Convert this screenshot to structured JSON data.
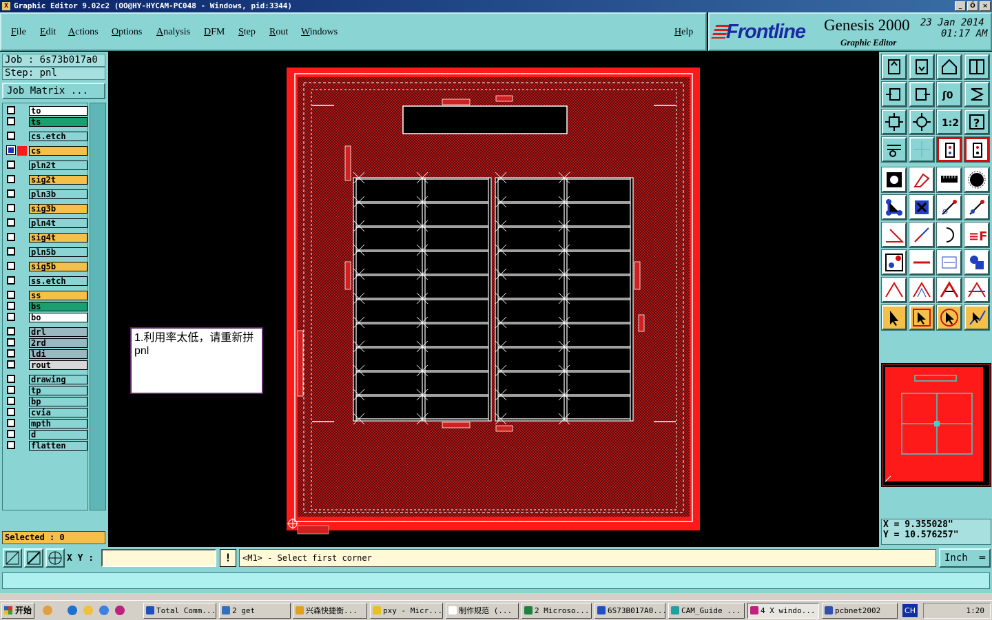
{
  "window": {
    "title": "Graphic Editor 9.02c2 (OO@HY-HYCAM-PC048 - Windows, pid:3344)",
    "buttons": [
      "_",
      "Ő",
      "×"
    ]
  },
  "menu": {
    "items": [
      "File",
      "Edit",
      "Actions",
      "Options",
      "Analysis",
      "DFM",
      "Step",
      "Rout",
      "Windows"
    ],
    "help": "Help"
  },
  "brand": {
    "logo": "Frontline",
    "product": "Genesis 2000",
    "subtitle": "Graphic Editor",
    "date": "23 Jan 2014",
    "time": "01:17 AM"
  },
  "job": {
    "job_line": "Job : 6s73b017a0",
    "step_line": "Step: pnl",
    "matrix_button": "Job Matrix ..."
  },
  "layers": [
    {
      "name": "to",
      "color": "#ffffff"
    },
    {
      "name": "ts",
      "color": "#1aa070"
    },
    {
      "name": "cs.etch",
      "color": "#8ad4d4"
    },
    {
      "name": "cs",
      "color": "#f5c04a",
      "active": true
    },
    {
      "name": "pln2t",
      "color": "#8ad4d4"
    },
    {
      "name": "sig2t",
      "color": "#f5c04a"
    },
    {
      "name": "pln3b",
      "color": "#8ad4d4"
    },
    {
      "name": "sig3b",
      "color": "#f5c04a"
    },
    {
      "name": "pln4t",
      "color": "#8ad4d4"
    },
    {
      "name": "sig4t",
      "color": "#f5c04a"
    },
    {
      "name": "pln5b",
      "color": "#8ad4d4"
    },
    {
      "name": "sig5b",
      "color": "#f5c04a"
    },
    {
      "name": "ss.etch",
      "color": "#8ad4d4"
    },
    {
      "name": "ss",
      "color": "#f5c04a"
    },
    {
      "name": "bs",
      "color": "#1aa070"
    },
    {
      "name": "bo",
      "color": "#ffffff"
    },
    {
      "name": "drl",
      "color": "#9ab8c0"
    },
    {
      "name": "2rd",
      "color": "#9ab8c0"
    },
    {
      "name": "ldi",
      "color": "#9ab8c0"
    },
    {
      "name": "rout",
      "color": "#d8d8d8"
    },
    {
      "name": "drawing",
      "color": "#8ad4d4"
    },
    {
      "name": "tp",
      "color": "#8ad4d4"
    },
    {
      "name": "bp",
      "color": "#8ad4d4"
    },
    {
      "name": "cvia",
      "color": "#8ad4d4"
    },
    {
      "name": "mpth",
      "color": "#8ad4d4"
    },
    {
      "name": "d",
      "color": "#8ad4d4"
    },
    {
      "name": "flatten",
      "color": "#8ad4d4"
    }
  ],
  "selected": "Selected : 0",
  "note": "1.利用率太低，请重新拼pnl",
  "coords": {
    "x": "X = 9.355028\"",
    "y": "Y = 10.576257\""
  },
  "command": {
    "xy_label": "X Y :",
    "xy_value": "",
    "info_button": "!",
    "prompt": "<M1> - Select first corner",
    "units": "Inch"
  },
  "taskbar": {
    "start": "开始",
    "tasks": [
      {
        "label": "Total Comm...",
        "color": "#2050c0"
      },
      {
        "label": "2 get",
        "color": "#3070c0"
      },
      {
        "label": "兴森快捷衡...",
        "color": "#e0a020"
      },
      {
        "label": "pxy - Micr...",
        "color": "#e8c020"
      },
      {
        "label": "制作规范 (...",
        "color": "#ffffff"
      },
      {
        "label": "2 Microso...",
        "color": "#208040"
      },
      {
        "label": "6S73B017A0...",
        "color": "#2050c0"
      },
      {
        "label": "CAM_Guide ...",
        "color": "#20a0a0"
      },
      {
        "label": "4 X windo...",
        "color": "#c02080",
        "pressed": true
      },
      {
        "label": "pcbnet2002",
        "color": "#3050b0"
      }
    ],
    "lang": "CH",
    "clock": "1:20"
  }
}
